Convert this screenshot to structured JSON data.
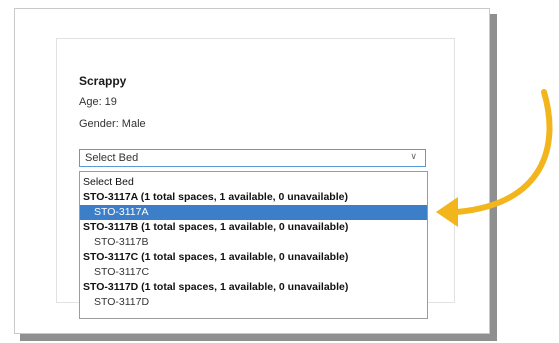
{
  "person": {
    "name": "Scrappy",
    "age": "Age: 19",
    "gender": "Gender: Male"
  },
  "bed_select": {
    "selected_value": "Select Bed",
    "options": [
      {
        "label": "Select Bed",
        "kind": "placeholder",
        "selected": false
      },
      {
        "label": "STO-3117A (1 total spaces, 1 available, 0 unavailable)",
        "kind": "group",
        "selected": false
      },
      {
        "label": "STO-3117A",
        "kind": "child",
        "selected": true
      },
      {
        "label": "STO-3117B (1 total spaces, 1 available, 0 unavailable)",
        "kind": "group",
        "selected": false
      },
      {
        "label": "STO-3117B",
        "kind": "child",
        "selected": false
      },
      {
        "label": "STO-3117C (1 total spaces, 1 available, 0 unavailable)",
        "kind": "group",
        "selected": false
      },
      {
        "label": "STO-3117C",
        "kind": "child",
        "selected": false
      },
      {
        "label": "STO-3117D (1 total spaces, 1 available, 0 unavailable)",
        "kind": "group",
        "selected": false
      },
      {
        "label": "STO-3117D",
        "kind": "child",
        "selected": false
      }
    ]
  },
  "colors": {
    "highlight": "#3c7fc8",
    "annotation_arrow": "#f2b51c",
    "focus_border": "#5b9bd5"
  },
  "icons": {
    "dropdown": "chevron-down-icon",
    "annotation": "curved-arrow-icon"
  }
}
